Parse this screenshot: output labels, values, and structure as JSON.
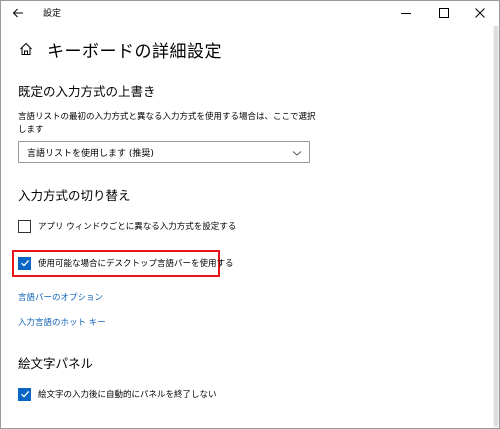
{
  "window": {
    "app_title": "設定",
    "controls": {
      "minimize": "—",
      "maximize": "☐",
      "close": "✕"
    }
  },
  "header": {
    "title": "キーボードの詳細設定"
  },
  "override_section": {
    "heading": "既定の入力方式の上書き",
    "description": "言語リストの最初の入力方式と異なる入力方式を使用する場合は、ここで選択します",
    "dropdown_value": "言語リストを使用します (推奨)"
  },
  "switch_section": {
    "heading": "入力方式の切り替え",
    "option_per_app": {
      "label": "アプリ ウィンドウごとに異なる入力方式を設定する",
      "checked": false
    },
    "option_desktop_bar": {
      "label": "使用可能な場合にデスクトップ言語バーを使用する",
      "checked": true
    },
    "link_language_bar_options": "言語バーのオプション",
    "link_hotkeys": "入力言語のホット キー"
  },
  "emoji_section": {
    "heading": "絵文字パネル",
    "option_auto_close": {
      "label": "絵文字の入力後に自動的にパネルを終了しない",
      "checked": true
    }
  },
  "colors": {
    "accent": "#0a66c4",
    "link": "#0a5fb8",
    "highlight": "#e8161a"
  },
  "icons": {
    "back": "back-arrow-icon",
    "home": "home-icon",
    "dropdown": "chevron-down-icon",
    "check": "checkmark-icon"
  }
}
